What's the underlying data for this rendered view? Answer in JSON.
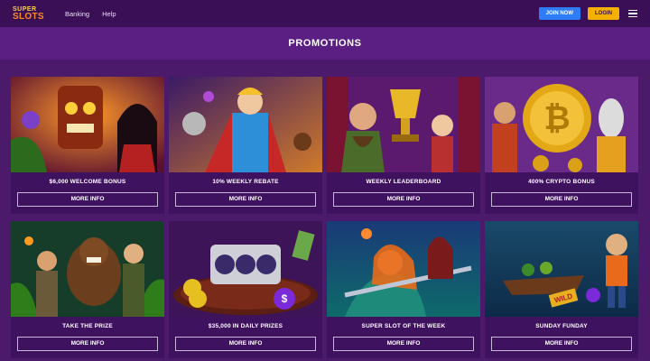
{
  "brand": {
    "logo_line1": "SUPER",
    "logo_line2": "SLOTS"
  },
  "nav": [
    {
      "label": "Banking"
    },
    {
      "label": "Help"
    }
  ],
  "header_buttons": {
    "join": "JOIN NOW",
    "login": "LOGIN"
  },
  "page_title": "PROMOTIONS",
  "promos": [
    {
      "title": "$6,000 WELCOME BONUS",
      "button": "MORE INFO",
      "art": "tiki"
    },
    {
      "title": "10% WEEKLY REBATE",
      "button": "MORE INFO",
      "art": "hero"
    },
    {
      "title": "WEEKLY LEADERBOARD",
      "button": "MORE INFO",
      "art": "trophy"
    },
    {
      "title": "400% CRYPTO BONUS",
      "button": "MORE INFO",
      "art": "bitcoin"
    },
    {
      "title": "TAKE THE PRIZE",
      "button": "MORE INFO",
      "art": "bear"
    },
    {
      "title": "$35,000 IN DAILY PRIZES",
      "button": "MORE INFO",
      "art": "slot"
    },
    {
      "title": "SUPER SLOT OF THE WEEK",
      "button": "MORE INFO",
      "art": "mermaid"
    },
    {
      "title": "SUNDAY FUNDAY",
      "button": "MORE INFO",
      "art": "boat"
    }
  ],
  "colors": {
    "background": "#4b1a6b",
    "topbar": "#3a0f55",
    "join_button": "#2e7cf6",
    "login_button": "#f5b000"
  }
}
